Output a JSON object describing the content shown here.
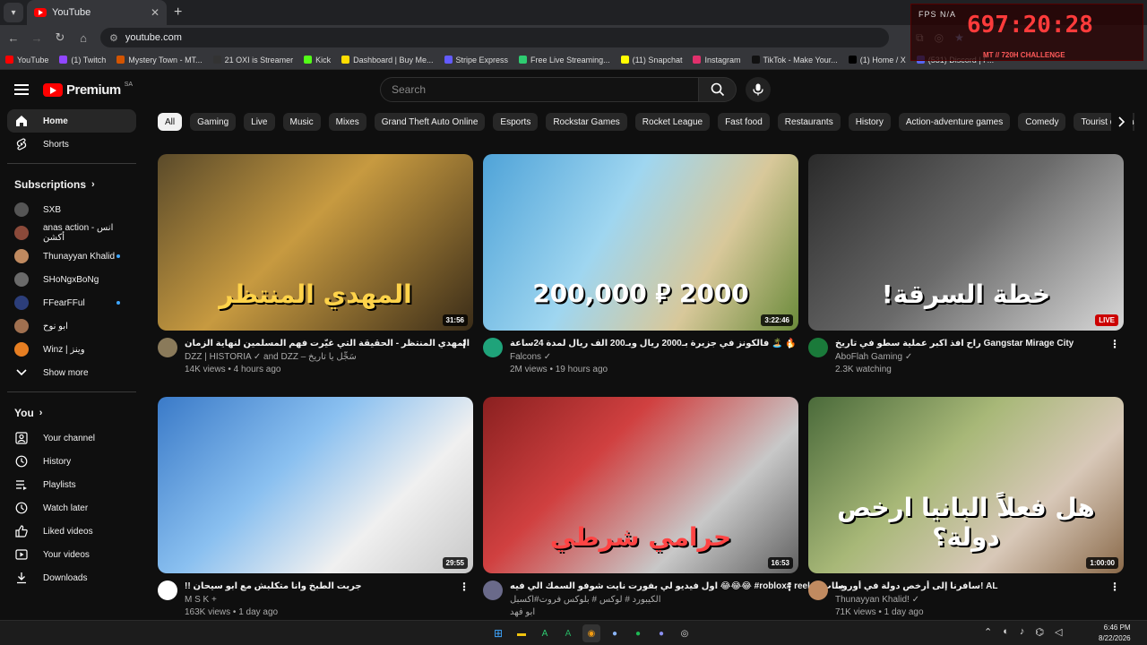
{
  "browser": {
    "tab_title": "YouTube",
    "url": "youtube.com",
    "bookmarks": [
      {
        "label": "YouTube",
        "color": "#ff0000"
      },
      {
        "label": "(1) Twitch",
        "color": "#9146ff"
      },
      {
        "label": "Mystery Town - MT...",
        "color": "#d35400"
      },
      {
        "label": "21 OXI is Streamer",
        "color": "#333333"
      },
      {
        "label": "Kick",
        "color": "#53fc18"
      },
      {
        "label": "Dashboard | Buy Me...",
        "color": "#ffdd00"
      },
      {
        "label": "Stripe Express",
        "color": "#635bff"
      },
      {
        "label": "Free Live Streaming...",
        "color": "#2ecc71"
      },
      {
        "label": "(11) Snapchat",
        "color": "#fffc00"
      },
      {
        "label": "Instagram",
        "color": "#e1306c"
      },
      {
        "label": "TikTok - Make Your...",
        "color": "#111111"
      },
      {
        "label": "(1) Home / X",
        "color": "#000000"
      },
      {
        "label": "(531) Discord | F...",
        "color": "#5865f2"
      }
    ]
  },
  "overlay": {
    "fps_label": "FPS N/A",
    "timer": "697:20:28",
    "challenge": "MT // 720H CHALLENGE"
  },
  "header": {
    "logo_text": "Premium",
    "country_code": "SA",
    "search_placeholder": "Search"
  },
  "sidebar": {
    "main": [
      {
        "label": "Home",
        "icon": "home-icon",
        "active": true
      },
      {
        "label": "Shorts",
        "icon": "shorts-icon",
        "active": false
      }
    ],
    "subscriptions_title": "Subscriptions",
    "subscriptions": [
      {
        "label": "SXB",
        "color": "#555555",
        "live": false
      },
      {
        "label": "anas action - انس أكشن",
        "color": "#8b4a3a",
        "live": false
      },
      {
        "label": "Thunayyan Khalid",
        "color": "#c08a60",
        "live": true
      },
      {
        "label": "SHoNgxBoNg",
        "color": "#6a6a6a",
        "live": false
      },
      {
        "label": "FFearFFul",
        "color": "#2c3e7a",
        "live": true
      },
      {
        "label": "ابو نوح",
        "color": "#a07050",
        "live": false
      },
      {
        "label": "Winz | وينز",
        "color": "#e67e22",
        "live": false
      }
    ],
    "show_more": "Show more",
    "you_title": "You",
    "you_items": [
      {
        "label": "Your channel",
        "icon": "channel-icon"
      },
      {
        "label": "History",
        "icon": "history-icon"
      },
      {
        "label": "Playlists",
        "icon": "playlists-icon"
      },
      {
        "label": "Watch later",
        "icon": "watch-later-icon"
      },
      {
        "label": "Liked videos",
        "icon": "liked-icon"
      },
      {
        "label": "Your videos",
        "icon": "your-videos-icon"
      },
      {
        "label": "Downloads",
        "icon": "downloads-icon"
      }
    ]
  },
  "chips": [
    "All",
    "Gaming",
    "Live",
    "Music",
    "Mixes",
    "Grand Theft Auto Online",
    "Esports",
    "Rockstar Games",
    "Rocket League",
    "Fast food",
    "Restaurants",
    "History",
    "Action-adventure games",
    "Comedy",
    "Tourist destinations"
  ],
  "videos": [
    {
      "title": "المهدي المنتظر - الحقيقة التي غيّرت فهم المسلمين لنهاية الزمان",
      "channel": "DZZ | HISTORIA ✓ and DZZ – سَجِّل يا تاريخ",
      "stats": "14K views • 4 hours ago",
      "duration": "31:56",
      "thumb_text": "المهدي المنتظر",
      "thumb_bg": "linear-gradient(135deg,#5a4a2a 0%,#c79a40 45%,#3a2c18 100%)",
      "thumb_color": "#ffd34a",
      "avatar": "#8a7a5a"
    },
    {
      "title": "فالكونز في جزيرة بـ2000 ريال وبـ200 الف ريال لمدة 24ساعة 🏝️ 🔥",
      "channel": "Falcons ✓",
      "stats": "2M views • 19 hours ago",
      "duration": "3:22:46",
      "thumb_text": "2000 ⃁ 200,000",
      "thumb_bg": "linear-gradient(120deg,#4fa3d8 0%,#9fd6f0 40%,#d8c89a 70%,#6a8a3a 100%)",
      "thumb_color": "#ffffff",
      "avatar": "#1fa37a"
    },
    {
      "title": "راح افذ اكبر عملية سطو في تاريخ Gangstar Mirage City",
      "channel": "AboFlah Gaming ✓",
      "stats": "2.3K watching",
      "duration": "",
      "live": "LIVE",
      "thumb_text": "خطة السرقة!",
      "thumb_bg": "linear-gradient(135deg,#2a2a2a 0%,#6a6a6a 50%,#d8d8d8 100%)",
      "thumb_color": "#ffffff",
      "avatar": "#1a7a3a"
    },
    {
      "title": "!! جربت الطبخ وانا متكلبش مع ابو سيحان",
      "channel": "M S K +",
      "stats": "163K views • 1 day ago",
      "duration": "29:55",
      "thumb_text": "",
      "thumb_bg": "linear-gradient(135deg,#3a7ac8 0%,#8ac0f0 40%,#f0f0f0 70%,#c8c8c8 100%)",
      "thumb_color": "#ffffff",
      "avatar": "#ffffff"
    },
    {
      "title": "اول فيديو لي بفورت نايت شوفو السمك الي فيه 😂😂😂 #roblox# reels# ساب",
      "channel": "الكيبورد # لوكس # بلوكس فروت#اكسبل",
      "stats": "ابو فهد",
      "duration": "16:53",
      "thumb_text": "حرامي   شرطي",
      "thumb_bg": "linear-gradient(135deg,#8a2020 0%,#d04040 35%,#c8c8c8 70%,#606060 100%)",
      "thumb_color": "#ff4444",
      "avatar": "#6a6a8a"
    },
    {
      "title": "سافرنا إلى أرخص دولة في أوروبا! AL",
      "channel": "Thunayyan Khalid! ✓",
      "stats": "71K views • 1 day ago",
      "duration": "1:00:00",
      "thumb_text": "هل فعلاً البانيا ارخص دولة؟",
      "thumb_bg": "linear-gradient(135deg,#4a6a3a 0%,#a8b878 40%,#d8c8b8 70%,#8a6a4a 100%)",
      "thumb_color": "#ffffff",
      "avatar": "#c08a60"
    }
  ],
  "taskbar": {
    "time": "6:46 PM",
    "date": "8/22/2026"
  }
}
